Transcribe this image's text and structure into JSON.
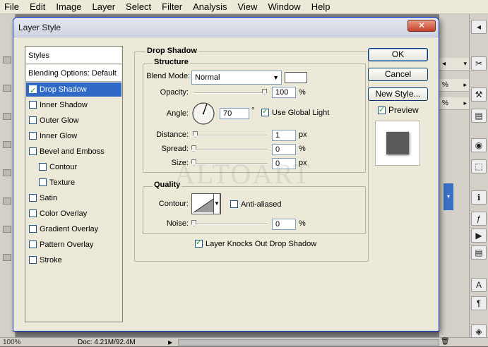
{
  "menubar": {
    "items": [
      "File",
      "Edit",
      "Image",
      "Layer",
      "Select",
      "Filter",
      "Analysis",
      "View",
      "Window",
      "Help"
    ]
  },
  "dialog": {
    "title": "Layer Style",
    "close_glyph": "✕"
  },
  "styles_list": {
    "header": "Styles",
    "blending": "Blending Options: Default",
    "items": [
      {
        "label": "Drop Shadow",
        "checked": true,
        "selected": true
      },
      {
        "label": "Inner Shadow",
        "checked": false
      },
      {
        "label": "Outer Glow",
        "checked": false
      },
      {
        "label": "Inner Glow",
        "checked": false
      },
      {
        "label": "Bevel and Emboss",
        "checked": false
      },
      {
        "label": "Contour",
        "checked": false,
        "indent": true
      },
      {
        "label": "Texture",
        "checked": false,
        "indent": true
      },
      {
        "label": "Satin",
        "checked": false
      },
      {
        "label": "Color Overlay",
        "checked": false
      },
      {
        "label": "Gradient Overlay",
        "checked": false
      },
      {
        "label": "Pattern Overlay",
        "checked": false
      },
      {
        "label": "Stroke",
        "checked": false
      }
    ]
  },
  "buttons": {
    "ok": "OK",
    "reset": "Cancel",
    "new_style": "New Style...",
    "preview": "Preview"
  },
  "drop_shadow": {
    "section_title": "Drop Shadow",
    "structure": {
      "title": "Structure",
      "blend_mode_label": "Blend Mode:",
      "blend_mode_value": "Normal",
      "shadow_color": "#ffffff",
      "opacity_label": "Opacity:",
      "opacity_value": "100",
      "opacity_unit": "%",
      "angle_label": "Angle:",
      "angle_value": "70",
      "angle_unit": "°",
      "use_global_light": "Use Global Light",
      "distance_label": "Distance:",
      "distance_value": "1",
      "distance_unit": "px",
      "spread_label": "Spread:",
      "spread_value": "0",
      "spread_unit": "%",
      "size_label": "Size:",
      "size_value": "0",
      "size_unit": "px"
    },
    "quality": {
      "title": "Quality",
      "contour_label": "Contour:",
      "anti_aliased": "Anti-aliased",
      "noise_label": "Noise:",
      "noise_value": "0",
      "noise_unit": "%"
    },
    "knockout": "Layer Knocks Out Drop Shadow"
  },
  "status": {
    "zoom": "100%",
    "doc": "Doc: 4.21M/92.4M"
  },
  "watermark": "ALTOART",
  "icons": [
    "close-icon",
    "dropdown-arrow-icon",
    "angle-dial-icon",
    "contour-curve-icon",
    "trash-icon"
  ]
}
